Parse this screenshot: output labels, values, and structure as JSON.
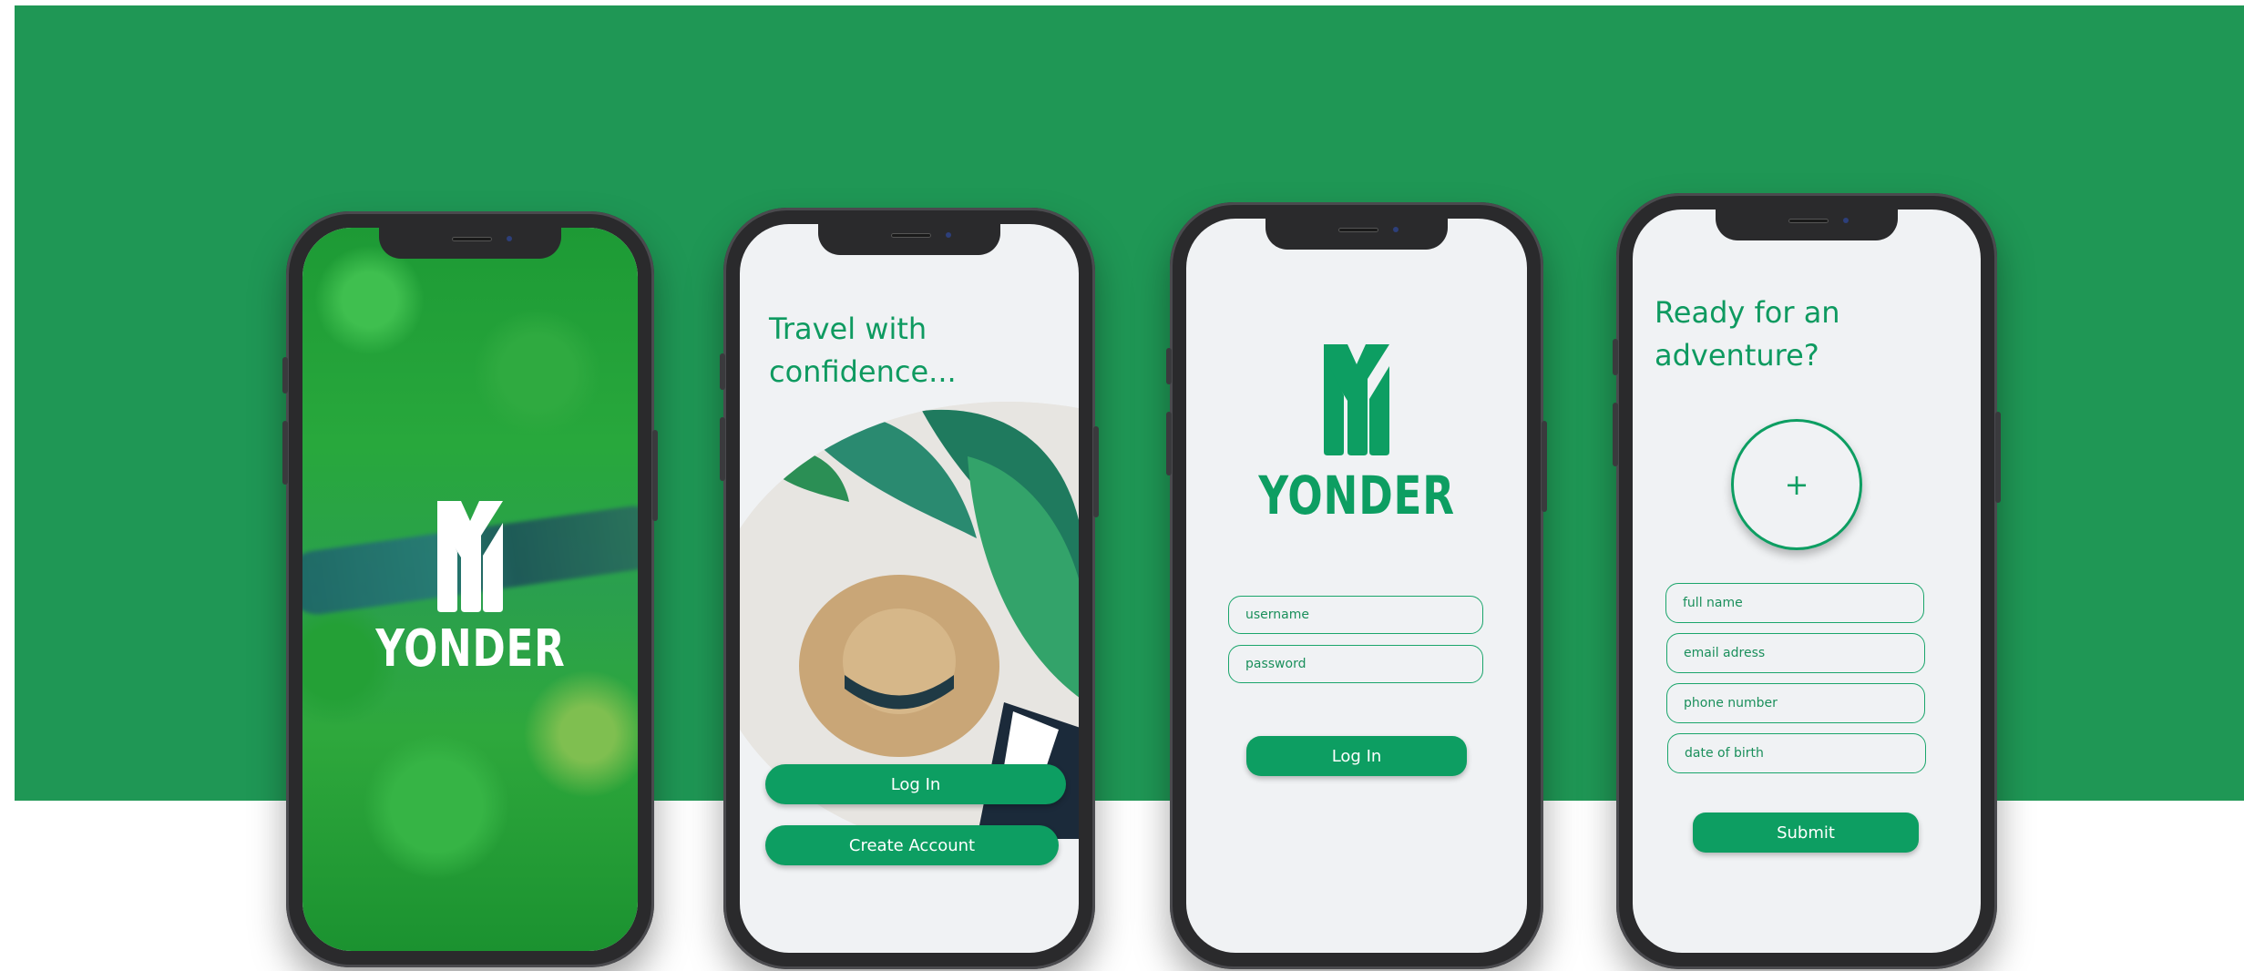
{
  "brand": {
    "name": "YONDER",
    "colors": {
      "banner": "#1f9755",
      "accent": "#0d9e62",
      "field_border": "#1aa56b",
      "screen_bg": "#f0f2f4"
    }
  },
  "splash": {
    "logo_icon": "yonder-y-logo-icon",
    "wordmark": "YONDER"
  },
  "welcome": {
    "headline_line1": "Travel with",
    "headline_line2": "confidence...",
    "login_label": "Log In",
    "create_account_label": "Create Account"
  },
  "login": {
    "wordmark": "YONDER",
    "username_placeholder": "username",
    "password_placeholder": "password",
    "login_label": "Log In"
  },
  "signup": {
    "headline_line1": "Ready for an",
    "headline_line2": "adventure?",
    "add_photo_symbol": "+",
    "full_name_placeholder": "full name",
    "email_placeholder": "email adress",
    "phone_placeholder": "phone number",
    "dob_placeholder": "date of birth",
    "submit_label": "Submit"
  }
}
